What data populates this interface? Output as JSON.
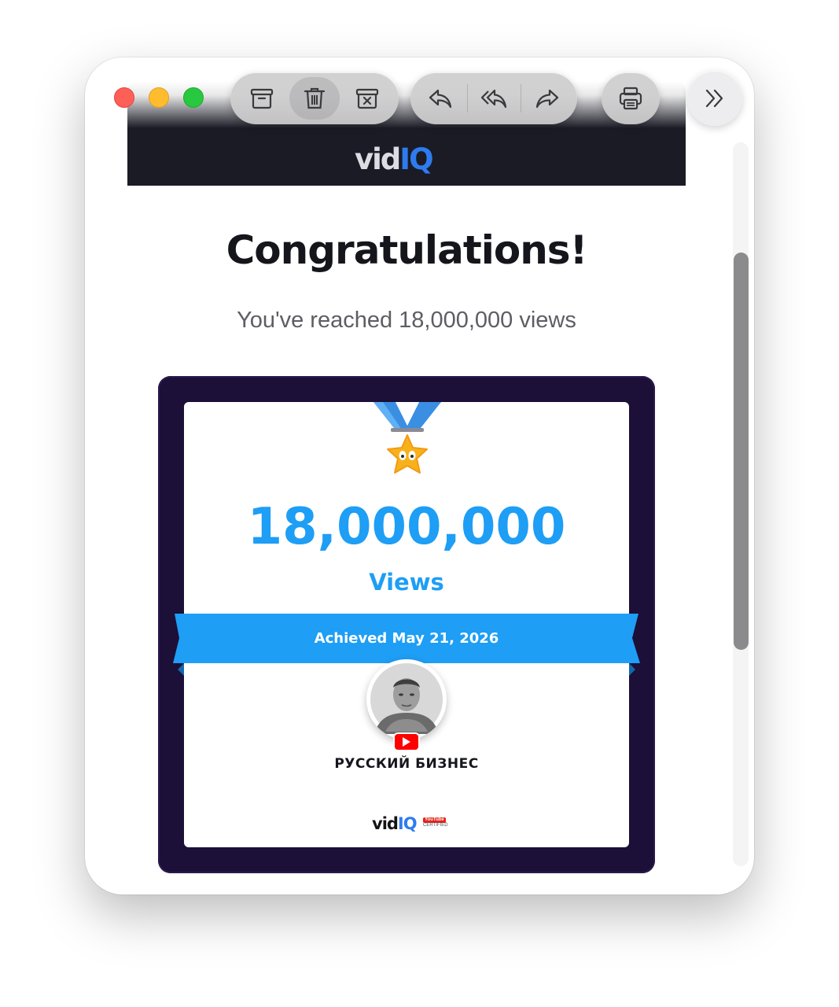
{
  "toolbar": {
    "archive_icon": "archive-icon",
    "trash_icon": "trash-icon",
    "junk_icon": "junk-icon",
    "reply_icon": "reply-icon",
    "reply_all_icon": "reply-all-icon",
    "forward_icon": "forward-icon",
    "print_icon": "print-icon",
    "more_icon": "chevrons-right-icon"
  },
  "email": {
    "header_logo": {
      "vid": "vid",
      "iq": "IQ"
    },
    "title": "Congratulations!",
    "subtitle": "You've reached 18,000,000 views",
    "card": {
      "views_number": "18,000,000",
      "views_label": "Views",
      "achieved_text": "Achieved May 21, 2026",
      "channel_name": "РУССКИЙ БИЗНЕС",
      "footer_logo": {
        "vid": "vid",
        "iq": "IQ"
      },
      "cert_top": "YouTube",
      "cert_bottom": "CERTIFIED"
    }
  },
  "colors": {
    "accent_blue": "#1e9ef5",
    "card_frame": "#1c0f38",
    "header_bg": "#1a1b25"
  }
}
